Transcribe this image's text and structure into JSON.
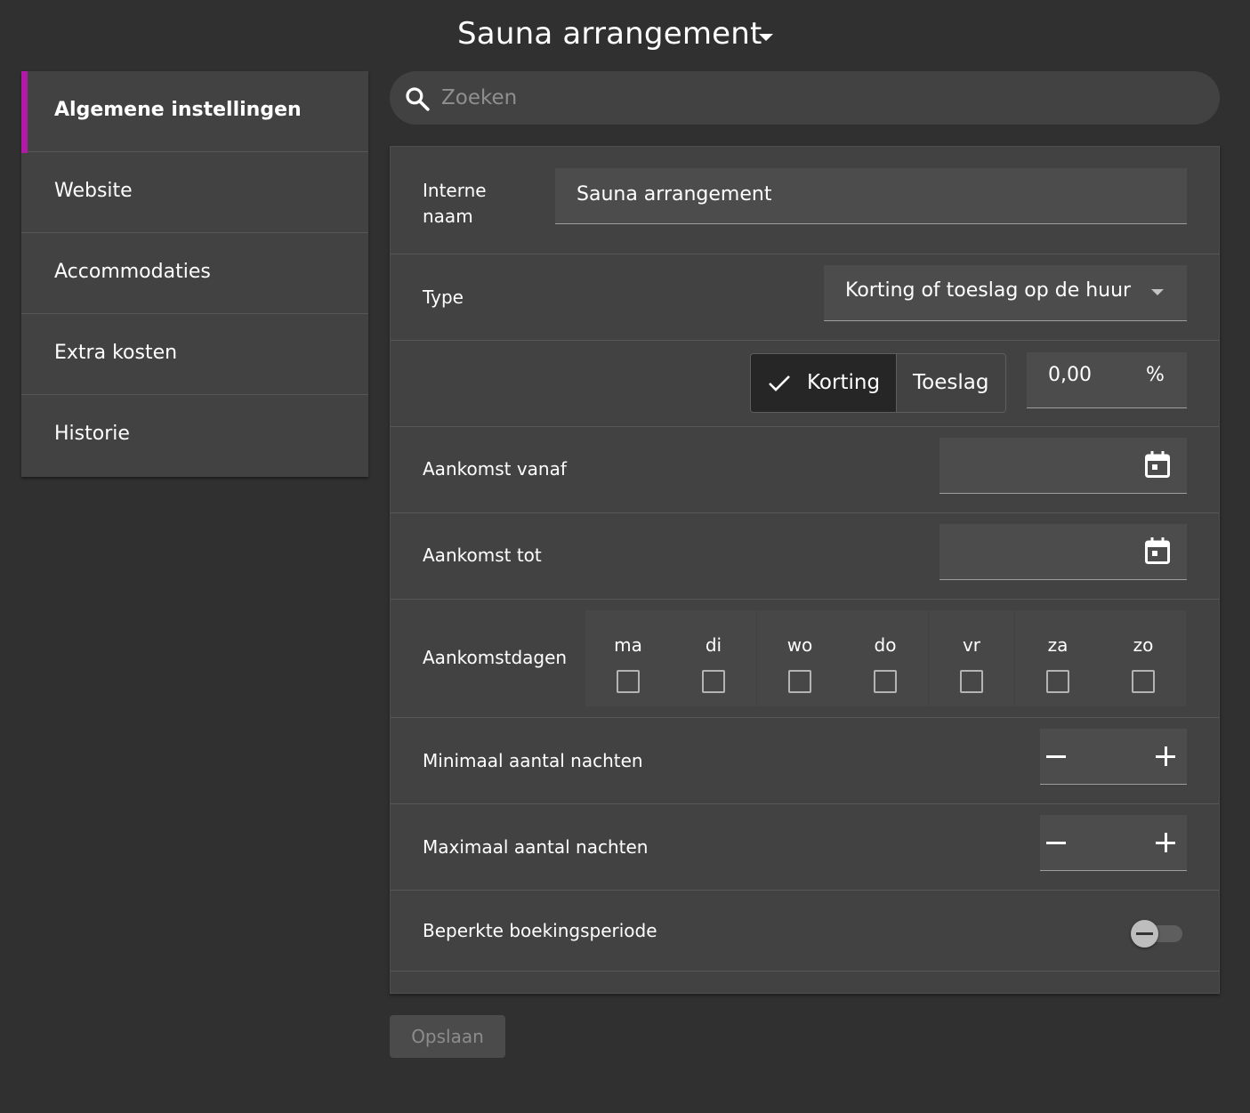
{
  "header": {
    "title": "Sauna arrangement"
  },
  "sidebar": {
    "items": [
      {
        "label": "Algemene instellingen",
        "active": true
      },
      {
        "label": "Website",
        "active": false
      },
      {
        "label": "Accommodaties",
        "active": false
      },
      {
        "label": "Extra kosten",
        "active": false
      },
      {
        "label": "Historie",
        "active": false
      }
    ],
    "accent_color": "#b01aa7"
  },
  "search": {
    "placeholder": "Zoeken",
    "icon": "search-icon"
  },
  "form": {
    "interne_naam": {
      "label": "Interne\nnaam",
      "value": "Sauna arrangement"
    },
    "type": {
      "label": "Type",
      "value": "Korting of toeslag op de huur"
    },
    "korting_toeslag": {
      "options": [
        "Korting",
        "Toeslag"
      ],
      "selected": "Korting",
      "amount": "0,00",
      "unit": "%"
    },
    "aankomst_vanaf": {
      "label": "Aankomst vanaf",
      "value": ""
    },
    "aankomst_tot": {
      "label": "Aankomst tot",
      "value": ""
    },
    "aankomstdagen": {
      "label": "Aankomstdagen",
      "days": [
        {
          "label": "ma",
          "checked": false
        },
        {
          "label": "di",
          "checked": false
        },
        {
          "label": "wo",
          "checked": false
        },
        {
          "label": "do",
          "checked": false
        },
        {
          "label": "vr",
          "checked": false
        },
        {
          "label": "za",
          "checked": false
        },
        {
          "label": "zo",
          "checked": false
        }
      ]
    },
    "min_nachten": {
      "label": "Minimaal aantal nachten",
      "value": ""
    },
    "max_nachten": {
      "label": "Maximaal aantal nachten",
      "value": ""
    },
    "beperkte_boekingsperiode": {
      "label": "Beperkte boekingsperiode",
      "enabled": false
    }
  },
  "actions": {
    "save_label": "Opslaan"
  }
}
